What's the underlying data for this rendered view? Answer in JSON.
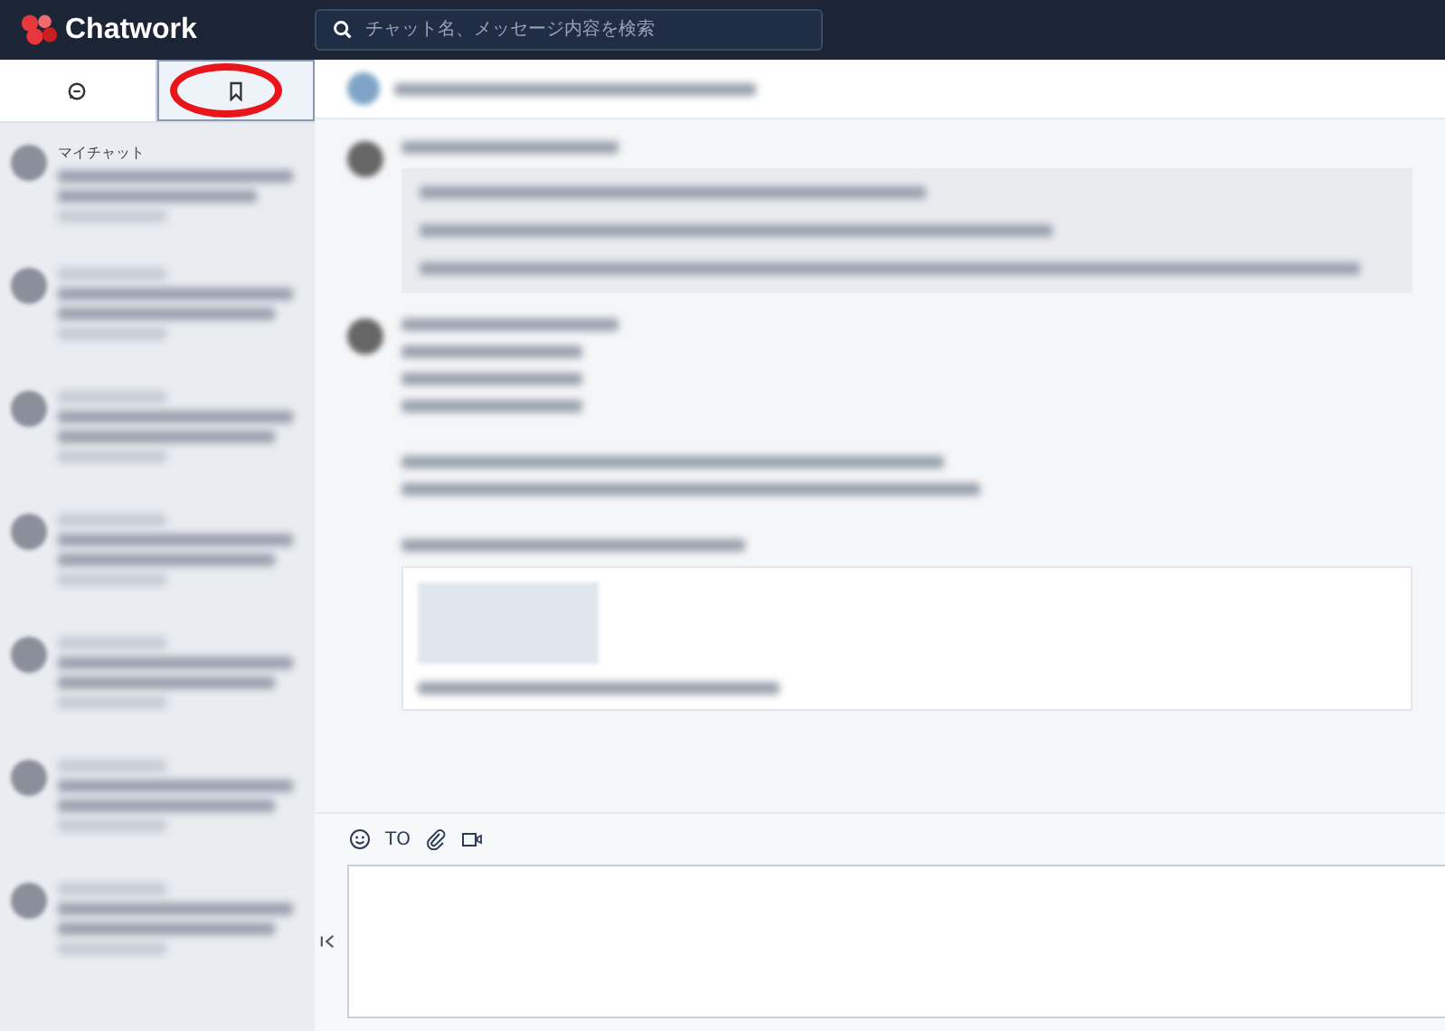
{
  "header": {
    "logo": "Chatwork",
    "search": {
      "placeholder": "チャット名、メッセージ内容を検索"
    }
  },
  "sidebar": {
    "tabs": [
      {
        "kind": "chat",
        "selected": false
      },
      {
        "kind": "bookmark",
        "selected": true
      }
    ],
    "chats": [
      {
        "room": "マイチャット"
      }
    ]
  },
  "composer": {
    "tools": [
      {
        "kind": "emoji"
      },
      {
        "kind": "to",
        "label": "TO"
      },
      {
        "kind": "attach"
      },
      {
        "kind": "video"
      }
    ]
  },
  "annotation": {
    "kind": "ellipse",
    "color": "#e8161b"
  }
}
